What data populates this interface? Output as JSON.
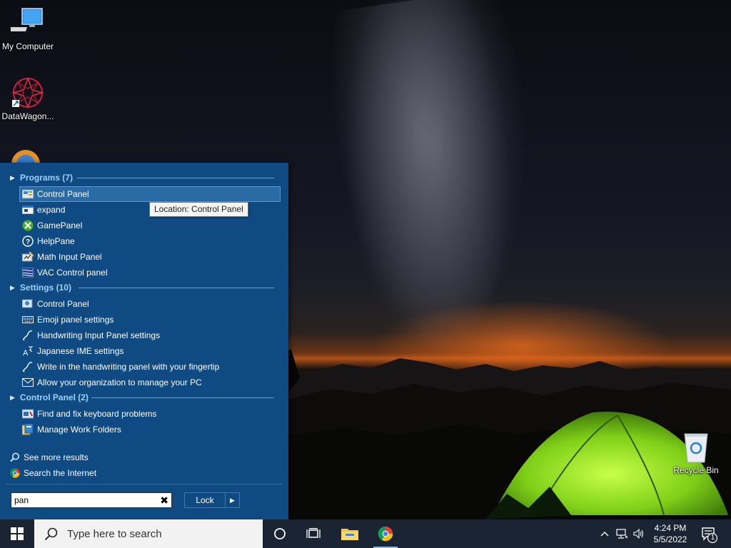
{
  "desktop": {
    "icons": [
      {
        "label": "My Computer",
        "icon": "computer-icon"
      },
      {
        "label": "DataWagon...",
        "icon": "datawagon-icon"
      },
      {
        "label": "Recycle Bin",
        "icon": "recycle-bin-icon"
      }
    ]
  },
  "start_menu": {
    "groups": [
      {
        "title": "Programs (7)",
        "items": [
          {
            "label": "Control Panel",
            "icon": "control-panel-icon"
          },
          {
            "label": "expand",
            "icon": "expand-icon"
          },
          {
            "label": "GamePanel",
            "icon": "xbox-icon"
          },
          {
            "label": "HelpPane",
            "icon": "help-icon"
          },
          {
            "label": "Math Input Panel",
            "icon": "math-input-icon"
          },
          {
            "label": "VAC Control panel",
            "icon": "vac-icon"
          }
        ]
      },
      {
        "title": "Settings (10)",
        "items": [
          {
            "label": "Control Panel",
            "icon": "control-panel-icon"
          },
          {
            "label": "Emoji panel settings",
            "icon": "keyboard-icon"
          },
          {
            "label": "Handwriting Input Panel settings",
            "icon": "pen-icon"
          },
          {
            "label": "Japanese IME settings",
            "icon": "ime-icon"
          },
          {
            "label": "Write in the handwriting panel with your fingertip",
            "icon": "pen-icon"
          },
          {
            "label": "Allow your organization to manage your PC",
            "icon": "mail-icon"
          }
        ]
      },
      {
        "title": "Control Panel (2)",
        "items": [
          {
            "label": "Find and fix keyboard problems",
            "icon": "troubleshoot-icon"
          },
          {
            "label": "Manage Work Folders",
            "icon": "work-folders-icon"
          }
        ]
      }
    ],
    "tooltip": "Location: Control Panel",
    "see_more": "See more results",
    "search_internet": "Search the Internet",
    "search_value": "pan",
    "clear_symbol": "✖",
    "lock_label": "Lock",
    "lock_arrow": "▶"
  },
  "taskbar": {
    "search_placeholder": "Type here to search",
    "time": "4:24 PM",
    "date": "5/5/2022",
    "notification_count": "1"
  },
  "colors": {
    "start_panel": "#0f4a82",
    "group_header": "#9cd1ff",
    "taskbar": "#1b2433"
  }
}
